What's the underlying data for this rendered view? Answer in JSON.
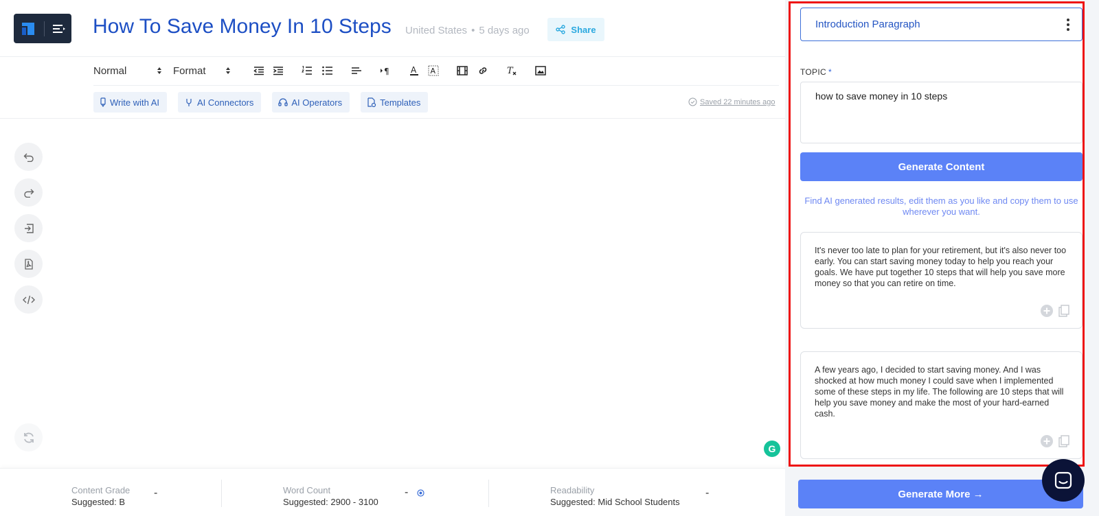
{
  "header": {
    "title": "How To Save Money In 10 Steps",
    "location": "United States",
    "time_ago": "5 days ago",
    "share_label": "Share"
  },
  "toolbar": {
    "style_select": "Normal",
    "format_select": "Format"
  },
  "ai_buttons": [
    {
      "label": "Write with AI"
    },
    {
      "label": "AI Connectors"
    },
    {
      "label": "AI Operators"
    },
    {
      "label": "Templates"
    }
  ],
  "saved_status": "Saved 22 minutes ago",
  "footer": {
    "content_grade": {
      "label": "Content Grade",
      "suggested": "Suggested: B",
      "value": "-"
    },
    "word_count": {
      "label": "Word Count",
      "suggested": "Suggested: 2900 - 3100",
      "value": "-"
    },
    "readability": {
      "label": "Readability",
      "suggested": "Suggested: Mid School Students",
      "value": "-"
    }
  },
  "panel": {
    "template_select": "Introduction Paragraph",
    "topic_label": "TOPIC",
    "topic_required": "*",
    "topic_value": "how to save money in 10 steps",
    "generate_label": "Generate Content",
    "hint": "Find AI generated results, edit them as you like and copy them to use wherever you want.",
    "results": [
      {
        "text": "It's never too late to plan for your retirement, but it's also never too early. You can start saving money today to help you reach your goals. We have put together 10 steps that will help you save more money so that you can retire on time."
      },
      {
        "text": "A few years ago, I decided to start saving money. And I was shocked at how much money I could save when I implemented some of these steps in my life. The following are 10 steps that will help you save money and make the most of your hard-earned cash."
      }
    ],
    "generate_more_label": "Generate More →"
  },
  "colors": {
    "accent": "#1d4fc4",
    "button": "#5b82f7",
    "highlight_border": "#ee1010",
    "grammarly": "#15c39a",
    "chat": "#0b1337"
  }
}
